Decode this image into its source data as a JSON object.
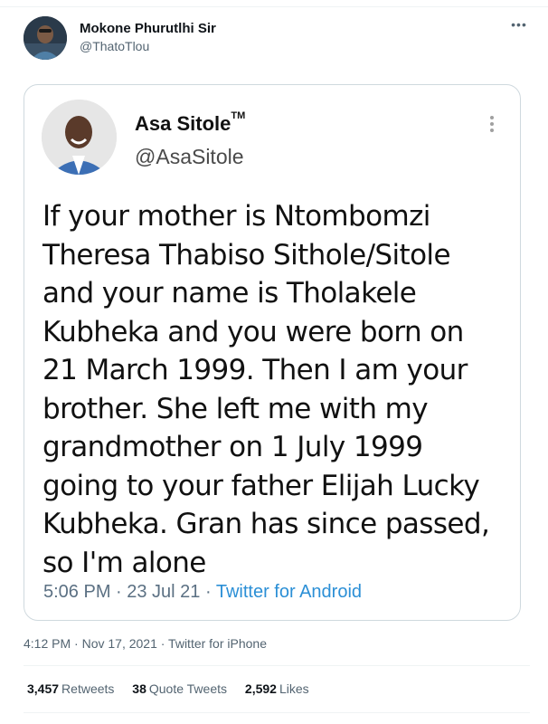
{
  "tweet": {
    "author": {
      "name": "Mokone Phurutlhi Sir",
      "handle": "@ThatoTlou"
    },
    "more_icon": "more-horizontal-icon",
    "more_glyph": "•••",
    "timestamp": "4:12 PM · Nov 17, 2021 · Twitter for iPhone",
    "stats": {
      "retweets": {
        "count": "3,457",
        "label": "Retweets"
      },
      "quotes": {
        "count": "38",
        "label": "Quote Tweets"
      },
      "likes": {
        "count": "2,592",
        "label": "Likes"
      }
    }
  },
  "embedded_screenshot": {
    "author": {
      "name": "Asa Sitole",
      "trademark": "TM",
      "handle": "@AsaSitole"
    },
    "menu_icon": "more-vertical-icon",
    "text_lines": [
      "If your mother is Ntombomzi",
      "Theresa Thabiso Sithole/Sitole",
      "and your name is Tholakele",
      "Kubheka and you were born on",
      "21 March 1999. Then I am your",
      "brother. She left me with my",
      "grandmother on 1 July 1999",
      "going to your father Elijah Lucky",
      "Kubheka. Gran has since passed,",
      "so I'm alone"
    ],
    "meta_time": "5:06 PM · 23 Jul 21 · ",
    "meta_source": "Twitter for Android"
  },
  "colors": {
    "text_primary": "#0f1419",
    "text_secondary": "#536471",
    "link_blue": "#2b8fd6",
    "border": "#cfd9de"
  }
}
